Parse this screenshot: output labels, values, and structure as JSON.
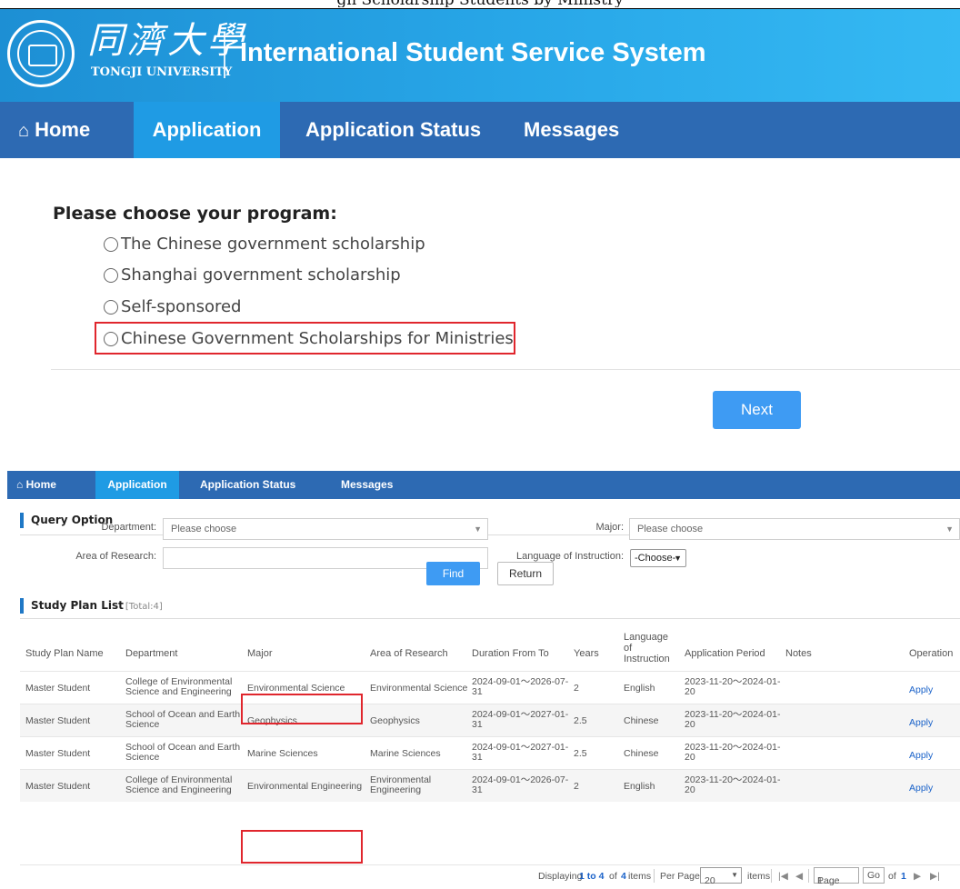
{
  "caption": {
    "text": "gn Scholarship Students by Ministry"
  },
  "screen1": {
    "univ_cn": "同濟大學",
    "univ_en": "TONGJI UNIVERSITY",
    "system_title": "International Student Service System",
    "nav": {
      "home": "Home",
      "application": "Application",
      "application_status": "Application Status",
      "messages": "Messages"
    },
    "prompt": "Please choose your program:",
    "options": [
      "The Chinese government scholarship",
      "Shanghai government scholarship",
      "Self-sponsored",
      "Chinese Government Scholarships for Ministries"
    ],
    "next_label": "Next"
  },
  "screen2": {
    "nav": {
      "home": "Home",
      "application": "Application",
      "application_status": "Application Status",
      "messages": "Messages"
    },
    "query_title": "Query Option",
    "department_label": "Department:",
    "department_value": "Please choose",
    "major_label": "Major:",
    "major_value": "Please choose",
    "area_label": "Area of Research:",
    "area_value": "",
    "language_label": "Language of Instruction:",
    "language_value": "-Choose-",
    "find_label": "Find",
    "return_label": "Return",
    "list_title": "Study Plan List",
    "list_total": "[Total:4]",
    "columns": {
      "name": "Study Plan Name",
      "department": "Department",
      "major": "Major",
      "area": "Area of Research",
      "duration": "Duration From To",
      "years": "Years",
      "language_1": "Language",
      "language_2": "of",
      "language_3": "Instruction",
      "period": "Application Period",
      "notes": "Notes",
      "operation": "Operation"
    },
    "rows": [
      {
        "name": "Master Student",
        "dept_1": "College of Environmental",
        "dept_2": "Science and Engineering",
        "major": "Environmental Science",
        "area_1": "Environmental Science",
        "area_2": "",
        "dur_1": "2024-09-01～2026-07-",
        "dur_2": "31",
        "years": "2",
        "language": "English",
        "period_1": "2023-11-20～2024-01-",
        "period_2": "20",
        "notes": "",
        "op": "Apply"
      },
      {
        "name": "Master Student",
        "dept_1": "School of Ocean and Earth",
        "dept_2": "Science",
        "major": "Geophysics",
        "area_1": "Geophysics",
        "area_2": "",
        "dur_1": "2024-09-01～2027-01-",
        "dur_2": "31",
        "years": "2.5",
        "language": "Chinese",
        "period_1": "2023-11-20～2024-01-",
        "period_2": "20",
        "notes": "",
        "op": "Apply"
      },
      {
        "name": "Master Student",
        "dept_1": "School of Ocean and Earth",
        "dept_2": "Science",
        "major": "Marine Sciences",
        "area_1": "Marine Sciences",
        "area_2": "",
        "dur_1": "2024-09-01～2027-01-",
        "dur_2": "31",
        "years": "2.5",
        "language": "Chinese",
        "period_1": "2023-11-20～2024-01-",
        "period_2": "20",
        "notes": "",
        "op": "Apply"
      },
      {
        "name": "Master Student",
        "dept_1": "College of Environmental",
        "dept_2": "Science and Engineering",
        "major": "Environmental Engineering",
        "area_1": "Environmental",
        "area_2": "Engineering",
        "dur_1": "2024-09-01～2026-07-",
        "dur_2": "31",
        "years": "2",
        "language": "English",
        "period_1": "2023-11-20～2024-01-",
        "period_2": "20",
        "notes": "",
        "op": "Apply"
      }
    ],
    "pager": {
      "displaying": "Displaying",
      "range": "1 to 4",
      "of_word": "of",
      "total": "4",
      "items_word": "items",
      "per_page": "Per Page",
      "per_page_value": "20",
      "items_word2": "items",
      "page_word": "Page",
      "page_value": "1",
      "go": "Go",
      "of_word2": "of",
      "page_total": "1"
    }
  },
  "colors": {
    "nav": "#2d6ab3",
    "nav_active": "#1f9be4",
    "header": "#28a7e8",
    "button": "#3e9bf3",
    "highlight": "#e0262d",
    "link": "#1a62c9"
  }
}
